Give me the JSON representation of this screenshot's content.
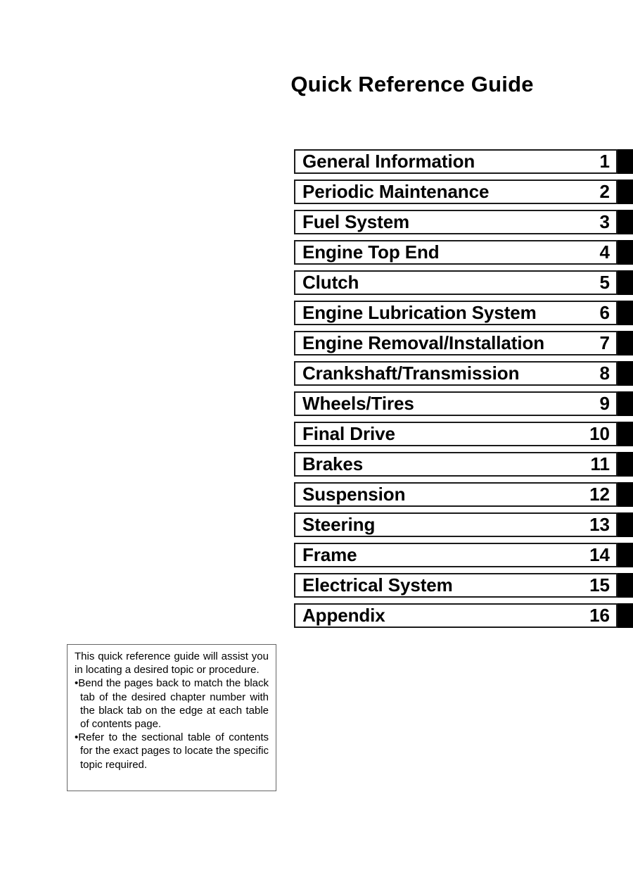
{
  "document": {
    "title": "Quick Reference Guide"
  },
  "chapters": [
    {
      "name": "General Information",
      "number": "1"
    },
    {
      "name": "Periodic Maintenance",
      "number": "2"
    },
    {
      "name": "Fuel System",
      "number": "3"
    },
    {
      "name": "Engine Top End",
      "number": "4"
    },
    {
      "name": "Clutch",
      "number": "5"
    },
    {
      "name": "Engine Lubrication System",
      "number": "6"
    },
    {
      "name": "Engine Removal/Installation",
      "number": "7"
    },
    {
      "name": "Crankshaft/Transmission",
      "number": "8"
    },
    {
      "name": "Wheels/Tires",
      "number": "9"
    },
    {
      "name": "Final Drive",
      "number": "10"
    },
    {
      "name": "Brakes",
      "number": "11"
    },
    {
      "name": "Suspension",
      "number": "12"
    },
    {
      "name": "Steering",
      "number": "13"
    },
    {
      "name": "Frame",
      "number": "14"
    },
    {
      "name": "Electrical System",
      "number": "15"
    },
    {
      "name": "Appendix",
      "number": "16"
    }
  ],
  "note": {
    "intro": "This quick reference guide will assist you in locating a desired topic or procedure.",
    "bullets": [
      "Bend the pages back to match the black tab of the desired chapter number with the black tab on the edge at each table of contents page.",
      "Refer to the sectional table of contents for the exact pages to locate the specific topic required."
    ],
    "bullet_marker": "•"
  },
  "colors": {
    "tab_black": "#000000",
    "box_border": "#1b1b1b",
    "note_border": "#666666",
    "page_background": "#ffffff",
    "text": "#000000"
  }
}
